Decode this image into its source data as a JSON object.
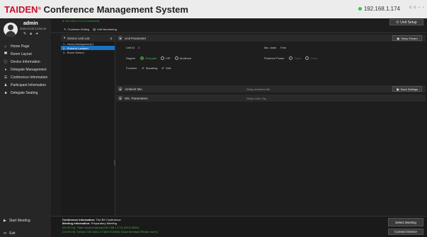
{
  "app": {
    "brand_name": "TAIDEN",
    "brand_reg": "®",
    "title": "Conference Management System",
    "ip": "192.168.1.174",
    "window_controls": [
      "o",
      "o",
      "–",
      "▫"
    ]
  },
  "user": {
    "name": "admin",
    "datetime": "2020-03-28 12:56:49"
  },
  "sidebar": {
    "items": [
      {
        "icon": "home-icon",
        "label": "Home Page"
      },
      {
        "icon": "room-icon",
        "label": "Room Layout"
      },
      {
        "icon": "info-icon",
        "label": "Device Information"
      },
      {
        "icon": "delegate-icon",
        "label": "Delegate Management"
      },
      {
        "icon": "list-icon",
        "label": "Conference Information"
      },
      {
        "icon": "participant-icon",
        "label": "Participant Information"
      },
      {
        "icon": "seating-icon",
        "label": "Delegate Seating"
      }
    ],
    "start_meeting": "Start Meeting",
    "exit": "Exit"
  },
  "main": {
    "status_text": "● 192.168.1.174 (Connected)",
    "unit_setup_button": "Unit Setup",
    "toolbar": {
      "chairman_setting": "Chairman Setting",
      "unit_numbering": "Unit Numbering"
    },
    "unit_list": {
      "header": "Device Unit List",
      "count": "3",
      "rows": [
        "1 - Henry Montgomer(C)",
        "2 - Roberto Lambert",
        "3 - Bruce Nelson"
      ]
    },
    "unit_parameter": {
      "header": "Unit Parameter",
      "setup_params_button": "Setup Param",
      "unit_id_label": "Unit ID",
      "unit_id_value": "2",
      "mic_state_label": "Mic. state",
      "mic_state_value": "Free",
      "degree_label": "Degree",
      "degree_options": [
        "Delegate",
        "VIP",
        "Audience"
      ],
      "phantom_label": "Phantom Power",
      "phantom_options": [
        "Open",
        "Close"
      ],
      "function_label": "Function",
      "function_options": [
        "Speaking",
        "Vote"
      ]
    },
    "ambient_mic": {
      "header": "Ambient Mic.",
      "sub": "Setup Ambient Mic.",
      "save_button": "Save Settings"
    },
    "mic_params": {
      "header": "Mic. Parameters",
      "sub": "Setup Gain, Eq..."
    },
    "bottom": {
      "conf_info_label": "Conference information:",
      "conf_info_value": "The BX Conference",
      "meeting_info_label": "Meeting information:",
      "meeting_info_value": "Preparatory Meeting",
      "log1": "[14:09:19] : Start connect device(192.168.1.174) (HCS-8300)",
      "log2": "[14:09:19] : Device 192.168.1.174(HCS-8300) Close terminal (Please use it)",
      "select_meeting": "Select Meeting",
      "connect_device": "Connect Device"
    }
  },
  "colors": {
    "accent_blue": "#1b72c6",
    "status_green": "#4caf50",
    "brand_red": "#c8102e"
  }
}
